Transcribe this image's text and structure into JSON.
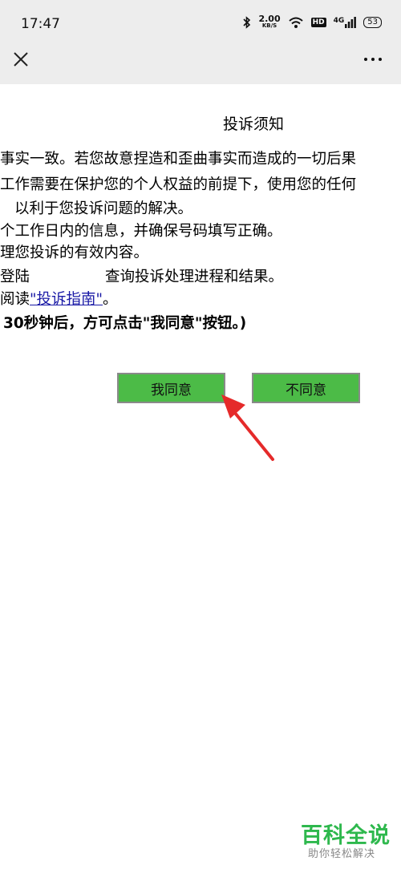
{
  "status": {
    "time": "17:47",
    "net_speed_value": "2.00",
    "net_speed_unit": "KB/S",
    "hd_label": "HD",
    "net_type": "4G",
    "battery": "53"
  },
  "topbar": {
    "close_icon": "close-icon",
    "more_icon": "more-icon"
  },
  "notice": {
    "title": "投诉须知",
    "line1": "事实一致。若您故意捏造和歪曲事实而造成的一切后果",
    "line2": "工作需要在保护您的个人权益的前提下，使用您的任何",
    "line3": "以利于您投诉问题的解决。",
    "line4": "个工作日内的信息，并确保号码填写正确。",
    "line5": "理您投诉的有效内容。",
    "line6a": "登陆",
    "line6b": "查询投诉处理进程和结果。",
    "line7_prefix": "阅读",
    "line7_link": "\"投诉指南\"",
    "line7_suffix": "。",
    "line8": "30秒钟后，方可点击\"我同意\"按钮。)"
  },
  "buttons": {
    "agree": "我同意",
    "disagree": "不同意"
  },
  "watermark": {
    "brand": "百科全说",
    "slogan": "助你轻松解决"
  },
  "colors": {
    "button_green": "#4cbb47",
    "arrow_red": "#e52a2a",
    "link_blue": "#1a1aa6",
    "brand_green": "#2eb84d"
  }
}
